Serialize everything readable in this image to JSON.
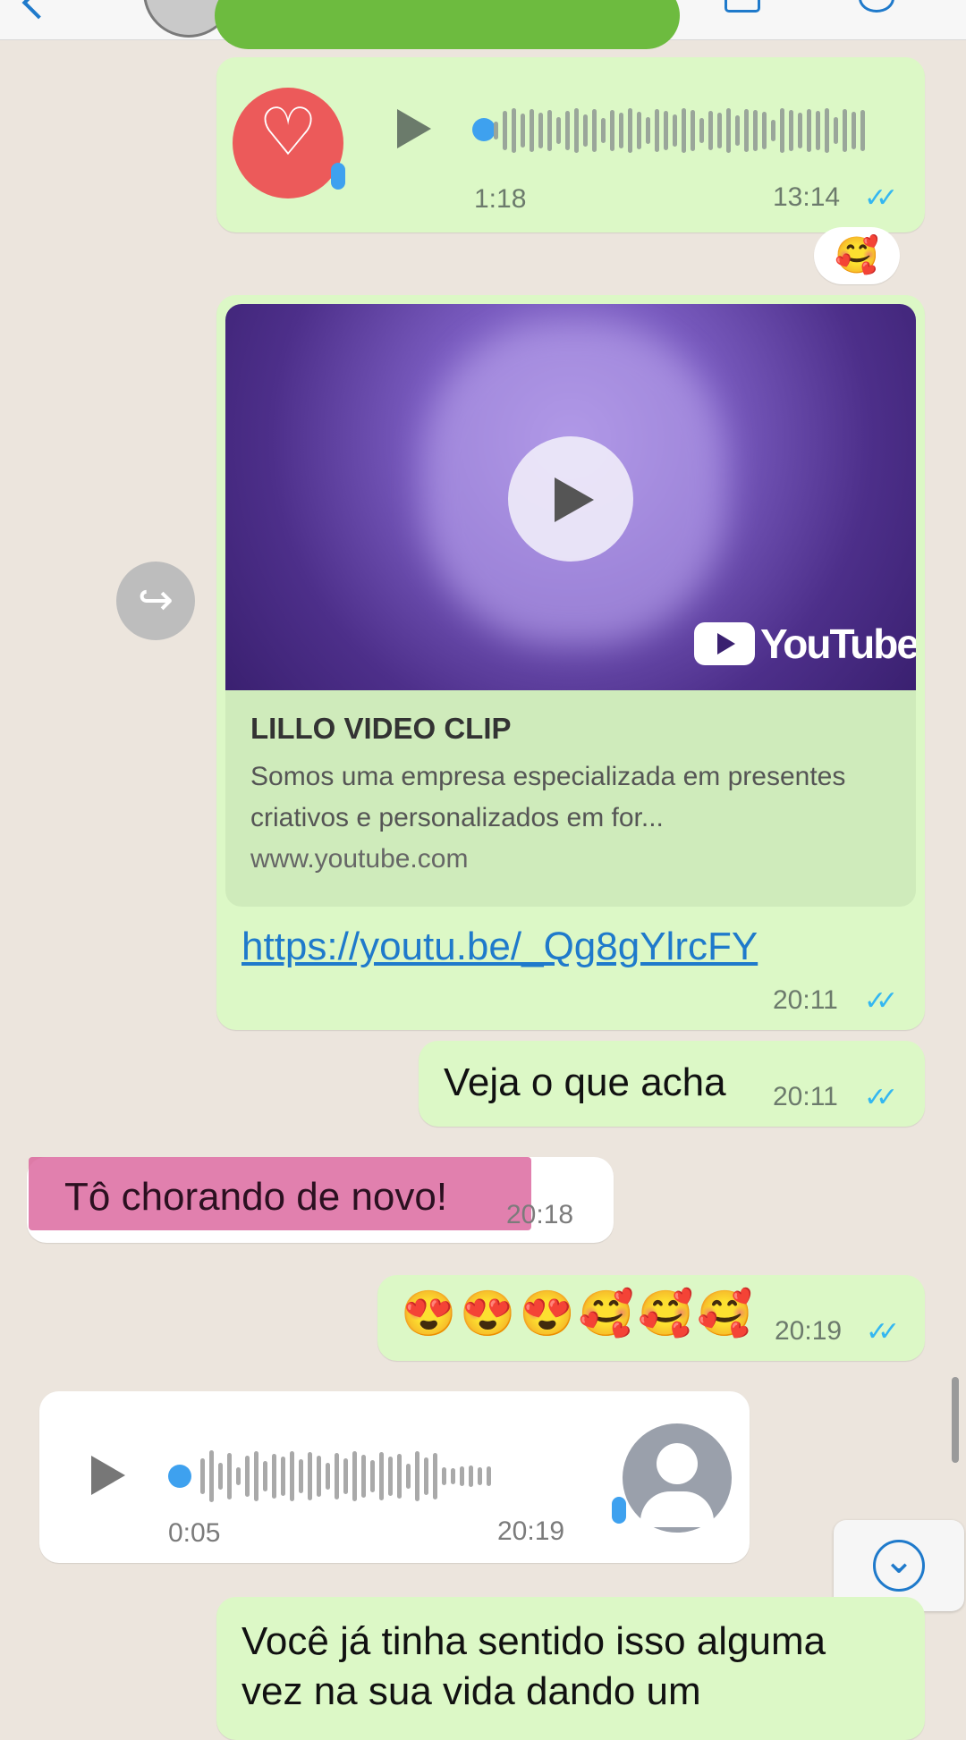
{
  "voice_out": {
    "duration": "1:18",
    "time": "13:14",
    "status": "read"
  },
  "reaction": {
    "emoji": "🥰"
  },
  "video_message": {
    "brand": "YouTube",
    "title": "LILLO VIDEO CLIP",
    "description": "Somos uma empresa especializada em presentes criativos e personalizados em for...",
    "domain": "www.youtube.com",
    "url": "https://youtu.be/_Qg8gYlrcFY",
    "time": "20:11"
  },
  "msg_veja": {
    "text": "Veja o que acha",
    "time": "20:11"
  },
  "msg_chorando": {
    "text": "Tô chorando de novo!",
    "time": "20:18"
  },
  "msg_emojis": {
    "text": "😍😍😍🥰🥰🥰",
    "time": "20:19"
  },
  "voice_in": {
    "duration": "0:05",
    "time": "20:19"
  },
  "msg_last": {
    "text": "Você já tinha sentido isso alguma vez na sua vida dando um"
  },
  "icons": {
    "ticks": "✓✓",
    "forward": "↪",
    "scroll_down": "⌄"
  }
}
